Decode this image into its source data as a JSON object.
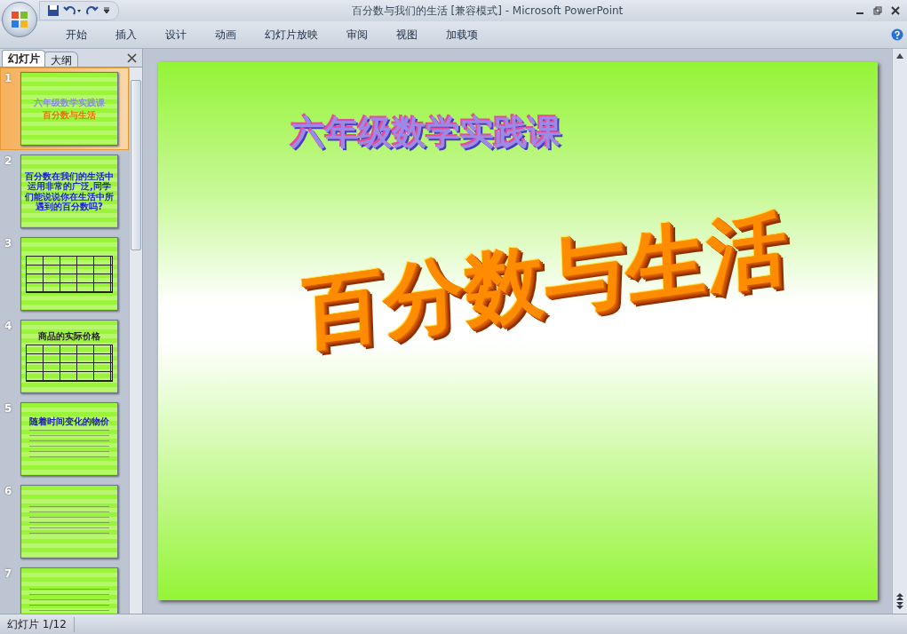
{
  "window": {
    "title": "百分数与我们的生活 [兼容模式] - Microsoft PowerPoint"
  },
  "ribbon": {
    "tabs": [
      "开始",
      "插入",
      "设计",
      "动画",
      "幻灯片放映",
      "审阅",
      "视图",
      "加载项"
    ]
  },
  "panel": {
    "tabs": [
      {
        "label": "幻灯片",
        "selected": true
      },
      {
        "label": "大纲",
        "selected": false
      }
    ],
    "slides": [
      {
        "number": "1",
        "selected": true,
        "kind": "title",
        "texts": [
          "六年级数学实践课",
          "百分数与生活"
        ]
      },
      {
        "number": "2",
        "selected": false,
        "kind": "text",
        "texts": [
          "百分数在我们的生活中运用非常的广泛,同学们能说说你在生活中所遇到的百分数吗?"
        ]
      },
      {
        "number": "3",
        "selected": false,
        "kind": "table"
      },
      {
        "number": "4",
        "selected": false,
        "kind": "table",
        "texts": [
          "商品的实际价格"
        ]
      },
      {
        "number": "5",
        "selected": false,
        "kind": "bullets",
        "texts": [
          "随着时间变化的物价"
        ]
      },
      {
        "number": "6",
        "selected": false,
        "kind": "bullets"
      },
      {
        "number": "7",
        "selected": false,
        "kind": "bullets"
      }
    ]
  },
  "slide": {
    "subtitle": "六年级数学实践课",
    "title": "百分数与生活"
  },
  "status_bar": {
    "text": "幻灯片 1/12"
  }
}
